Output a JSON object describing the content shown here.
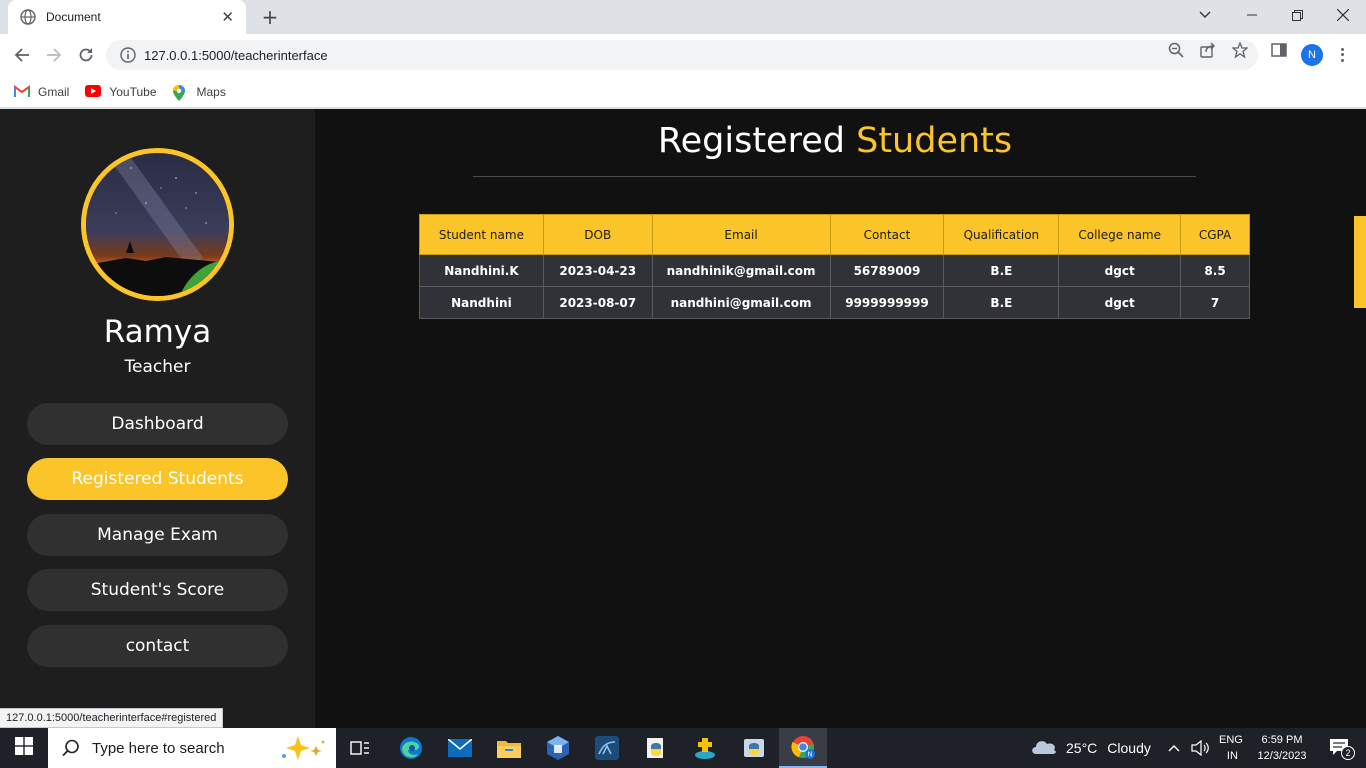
{
  "browser": {
    "tab_title": "Document",
    "url": "127.0.0.1:5000/teacherinterface",
    "profile_initial": "N",
    "bookmarks": [
      {
        "label": "Gmail",
        "icon": "gmail-icon"
      },
      {
        "label": "YouTube",
        "icon": "youtube-icon"
      },
      {
        "label": "Maps",
        "icon": "maps-icon"
      }
    ],
    "status_url": "127.0.0.1:5000/teacherinterface#registered"
  },
  "sidebar": {
    "user_name": "Ramya",
    "user_role": "Teacher",
    "nav": [
      {
        "label": "Dashboard",
        "active": false
      },
      {
        "label": "Registered Students",
        "active": true
      },
      {
        "label": "Manage Exam",
        "active": false
      },
      {
        "label": "Student's Score",
        "active": false
      },
      {
        "label": "contact",
        "active": false
      }
    ]
  },
  "main": {
    "title_part1": "Registered",
    "title_part2": "Students",
    "table": {
      "headers": [
        "Student name",
        "DOB",
        "Email",
        "Contact",
        "Qualification",
        "College name",
        "CGPA"
      ],
      "rows": [
        [
          "Nandhini.K",
          "2023-04-23",
          "nandhinik@gmail.com",
          "56789009",
          "B.E",
          "dgct",
          "8.5"
        ],
        [
          "Nandhini",
          "2023-08-07",
          "nandhini@gmail.com",
          "9999999999",
          "B.E",
          "dgct",
          "7"
        ]
      ]
    }
  },
  "taskbar": {
    "search_placeholder": "Type here to search",
    "weather_temp": "25°C",
    "weather_text": "Cloudy",
    "lang_top": "ENG",
    "lang_bottom": "IN",
    "time": "6:59 PM",
    "date": "12/3/2023",
    "notification_count": "2"
  },
  "colors": {
    "accent": "#fbc52a",
    "sidebar_bg": "#1e1e1e",
    "page_bg": "#111112",
    "row_bg": "#303237"
  }
}
